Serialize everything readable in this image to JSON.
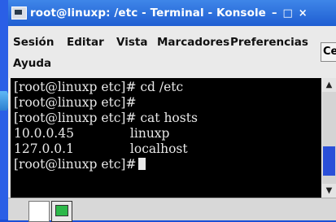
{
  "window": {
    "title": "root@linuxp: /etc - Terminal - Konsole",
    "title_buttons": [
      "–",
      "□",
      "×"
    ]
  },
  "menu": {
    "items": [
      "Sesión",
      "Editar",
      "Vista",
      "Marcadores",
      "Preferencias",
      "Ayuda"
    ],
    "side_button": "Ce"
  },
  "terminal": {
    "lines": [
      "[root@linuxp etc]# cd /etc",
      "[root@linuxp etc]#",
      "[root@linuxp etc]# cat hosts",
      "10.0.0.45              linuxp",
      "127.0.0.1              localhost",
      "[root@linuxp etc]#"
    ]
  },
  "scrollbar": {
    "up": "▲",
    "down": "▼"
  },
  "colors": {
    "titlebar": "#1f5ed2",
    "terminal_bg": "#000000",
    "scroll_thumb": "#2a4fd8"
  }
}
